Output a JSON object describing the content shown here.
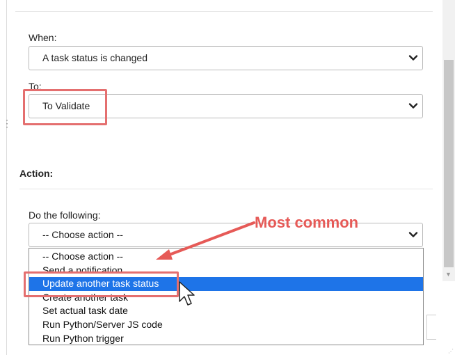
{
  "trigger": {
    "when_label": "When:",
    "when_value": "A task status is changed",
    "to_label": "To:",
    "to_value": "To Validate"
  },
  "action": {
    "section_title": "Action:",
    "do_label": "Do the following:",
    "select_value": "-- Choose action --",
    "options": [
      "-- Choose action --",
      "Send a notification",
      "Update another task status",
      "Create another task",
      "Set actual task date",
      "Run Python/Server JS code",
      "Run Python trigger"
    ],
    "highlighted_option": "Update another task status"
  },
  "annotation": {
    "callout_text": "Most common",
    "color": "#e65a57"
  },
  "colors": {
    "selection": "#1e74e8",
    "highlight_box": "#e46f6f"
  },
  "icons": [
    "chevron-down-icon",
    "drag-handle-icon",
    "mouse-pointer-icon",
    "annotation-arrow-icon",
    "resize-grip-icon"
  ]
}
